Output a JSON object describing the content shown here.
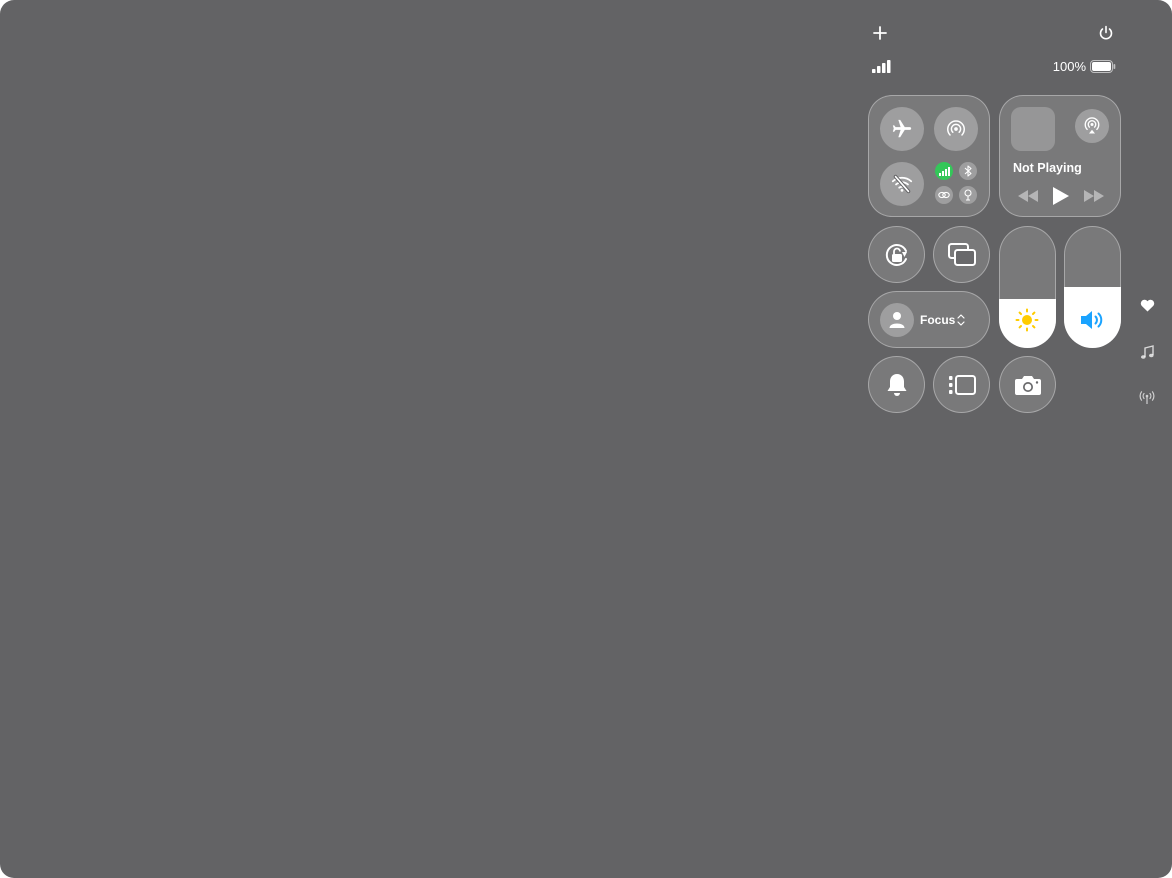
{
  "status_bar": {
    "battery_percent": "100%",
    "battery_level": 1.0,
    "signal_bars": 4
  },
  "media": {
    "now_playing": "Not Playing"
  },
  "focus": {
    "label": "Focus"
  },
  "sliders": {
    "brightness_level": 0.4,
    "volume_level": 0.5
  },
  "colors": {
    "background": "#636365",
    "cellular_active": "#34c759",
    "brightness_icon": "#ffcc00",
    "volume_icon": "#1aa3ff"
  },
  "icons": {
    "top_left": "plus-icon",
    "top_right": "power-icon",
    "side": [
      "heart-icon",
      "music-note-icon",
      "antenna-icon"
    ]
  }
}
